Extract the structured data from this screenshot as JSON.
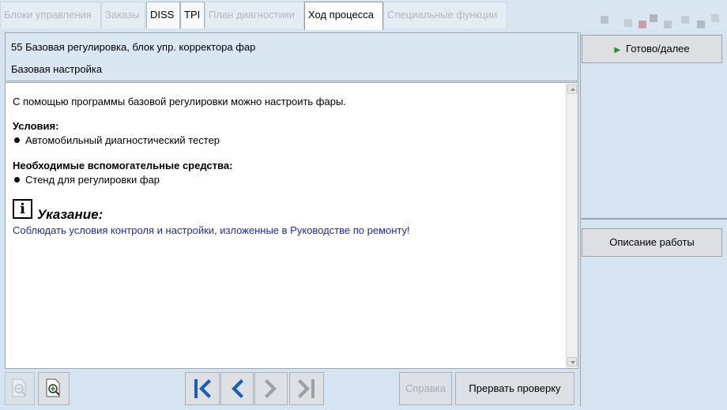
{
  "tabs": [
    {
      "label": "Блоки управления",
      "state": "disabled"
    },
    {
      "label": "Заказы",
      "state": "disabled"
    },
    {
      "label": "DISS",
      "state": "enabled"
    },
    {
      "label": "TPI",
      "state": "enabled"
    },
    {
      "label": "План диагностики",
      "state": "disabled"
    },
    {
      "label": "Ход процесса",
      "state": "active"
    },
    {
      "label": "Специальные функции",
      "state": "disabled"
    }
  ],
  "header": {
    "title": "55 Базовая регулировка, блок упр. корректора фар",
    "subtitle": "Базовая настройка"
  },
  "content": {
    "intro": "С помощью программы базовой регулировки можно настроить фары.",
    "conditions_heading": "Условия:",
    "conditions": [
      "Автомобильный диагностический тестер"
    ],
    "aux_heading": "Необходимые вспомогательные средства:",
    "aux": [
      "Стенд для регулировки фар"
    ],
    "note_icon": "i",
    "note_title": "Указание:",
    "note_text": "Соблюдать условия контроля и настройки, изложенные в Руководстве по ремонту!"
  },
  "toolbar": {
    "help_label": "Справка",
    "abort_label": "Прервать проверку"
  },
  "right": {
    "next_label": "Готово/далее",
    "description_label": "Описание работы"
  },
  "icons": {
    "zoom_out": "zoom-out-icon",
    "zoom_in": "zoom-in-icon",
    "first": "first-page-icon",
    "prev": "previous-icon",
    "next": "next-icon",
    "last": "last-page-icon",
    "play": "play-icon",
    "info": "info-icon"
  },
  "colors": {
    "accent_blue": "#1a5fb4",
    "note_text": "#1c2ea0",
    "panel_bg": "#dae6f2",
    "play_green": "#2a8a2a"
  }
}
